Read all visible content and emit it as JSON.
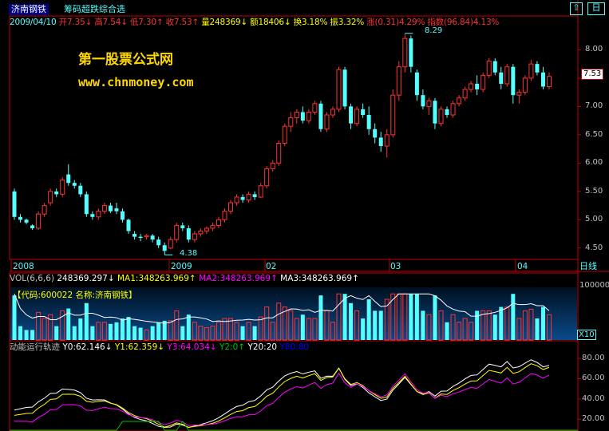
{
  "window": {
    "stock_name": "济南钢铁",
    "indicator_name": "筹码超跌综合选",
    "pct_label": "日"
  },
  "quote": {
    "date": "2009/04/10",
    "open": "开7.35",
    "high": "高7.54",
    "low": "低7.30",
    "close": "收7.53",
    "volume": "量248369",
    "amount": "额18406",
    "turnover": "换3.18%",
    "amplitude": "振3.32%",
    "change": "涨(0.31)4.29%",
    "index": "指数(96.84)4.13%"
  },
  "watermark": {
    "line1": "第一股票公式网",
    "line2": "www.chnmoney.com"
  },
  "colors": {
    "up": "#ff3232",
    "down": "#54ffff",
    "axis": "#c00000",
    "panel_text": "#54ffff",
    "white_line": "#ffffff",
    "yellow_line": "#ffff00",
    "magenta_line": "#ff00ff",
    "green_line": "#00c000",
    "watermark": "#ffd700"
  },
  "x_axis": {
    "labels": [
      "2008",
      "2009",
      "02",
      "03",
      "04"
    ],
    "period_label": "日线"
  },
  "vol_panel": {
    "label": "VOL(6,6,6)",
    "value": "248369.297",
    "ma1": "MA1:348263.969",
    "ma2": "MA2:348263.969",
    "ma3": "MA3:348263.969",
    "info": "【代码:600022 名称:济南钢铁】",
    "scale_label": "X10",
    "ticks": [
      "100000"
    ]
  },
  "energy_panel": {
    "label": "动能运行轨迹",
    "y0": "Y0:62.146",
    "y1": "Y1:62.359",
    "y3": "Y3:64.034",
    "y2": "Y2:0",
    "y20": "Y20:20",
    "y80": "Y80:80",
    "ticks": [
      "80.00",
      "60.00",
      "40.00",
      "20.00"
    ]
  },
  "chart_data": {
    "type": "candlestick",
    "y_ticks": [
      "8.00",
      "7.50",
      "7.00",
      "6.50",
      "6.00",
      "5.50",
      "5.00",
      "4.50"
    ],
    "ylim": [
      4.3,
      8.4
    ],
    "last_price": "7.53",
    "annotations": [
      {
        "text": "8.29",
        "index": 65,
        "value": 8.29
      },
      {
        "text": "4.38",
        "index": 25,
        "value": 4.38
      }
    ],
    "candles": [
      [
        5.5,
        5.55,
        5.0,
        5.05
      ],
      [
        5.05,
        5.1,
        4.95,
        5.0
      ],
      [
        5.0,
        5.02,
        4.92,
        4.95
      ],
      [
        4.9,
        4.92,
        4.82,
        4.85
      ],
      [
        4.85,
        5.15,
        4.82,
        5.1
      ],
      [
        5.1,
        5.3,
        5.05,
        5.25
      ],
      [
        5.3,
        5.55,
        5.25,
        5.5
      ],
      [
        5.5,
        5.55,
        5.4,
        5.45
      ],
      [
        5.45,
        5.75,
        5.4,
        5.7
      ],
      [
        5.8,
        5.98,
        5.6,
        5.65
      ],
      [
        5.65,
        5.7,
        5.55,
        5.6
      ],
      [
        5.6,
        5.65,
        5.4,
        5.45
      ],
      [
        5.45,
        5.5,
        5.05,
        5.1
      ],
      [
        5.1,
        5.15,
        5.0,
        5.05
      ],
      [
        5.05,
        5.2,
        5.0,
        5.15
      ],
      [
        5.15,
        5.3,
        5.1,
        5.25
      ],
      [
        5.25,
        5.3,
        5.12,
        5.15
      ],
      [
        5.2,
        5.3,
        5.1,
        5.15
      ],
      [
        5.15,
        5.2,
        4.95,
        5.0
      ],
      [
        5.0,
        5.02,
        4.75,
        4.8
      ],
      [
        4.75,
        4.8,
        4.65,
        4.7
      ],
      [
        4.7,
        4.75,
        4.62,
        4.68
      ],
      [
        4.7,
        4.75,
        4.65,
        4.72
      ],
      [
        4.72,
        4.75,
        4.6,
        4.65
      ],
      [
        4.65,
        4.7,
        4.5,
        4.55
      ],
      [
        4.55,
        4.6,
        4.38,
        4.45
      ],
      [
        4.5,
        4.7,
        4.48,
        4.65
      ],
      [
        4.65,
        4.95,
        4.6,
        4.9
      ],
      [
        4.9,
        4.95,
        4.8,
        4.85
      ],
      [
        4.85,
        4.9,
        4.6,
        4.65
      ],
      [
        4.65,
        4.8,
        4.6,
        4.75
      ],
      [
        4.75,
        4.85,
        4.7,
        4.8
      ],
      [
        4.8,
        4.88,
        4.75,
        4.85
      ],
      [
        4.85,
        4.95,
        4.8,
        4.9
      ],
      [
        4.9,
        5.05,
        4.85,
        5.0
      ],
      [
        5.0,
        5.2,
        4.95,
        5.15
      ],
      [
        5.15,
        5.35,
        5.1,
        5.3
      ],
      [
        5.3,
        5.45,
        5.25,
        5.4
      ],
      [
        5.4,
        5.45,
        5.3,
        5.35
      ],
      [
        5.35,
        5.5,
        5.3,
        5.45
      ],
      [
        5.45,
        5.5,
        5.35,
        5.4
      ],
      [
        5.4,
        5.65,
        5.38,
        5.6
      ],
      [
        5.6,
        5.95,
        5.55,
        5.9
      ],
      [
        5.9,
        6.05,
        5.85,
        6.0
      ],
      [
        6.0,
        6.4,
        5.95,
        6.35
      ],
      [
        6.35,
        6.7,
        6.3,
        6.65
      ],
      [
        6.65,
        6.9,
        6.55,
        6.8
      ],
      [
        6.8,
        6.95,
        6.7,
        6.9
      ],
      [
        6.9,
        7.0,
        6.7,
        6.75
      ],
      [
        6.75,
        6.95,
        6.7,
        6.9
      ],
      [
        6.9,
        7.1,
        6.85,
        7.05
      ],
      [
        7.05,
        7.1,
        6.55,
        6.6
      ],
      [
        6.6,
        6.9,
        6.55,
        6.85
      ],
      [
        6.85,
        7.0,
        6.8,
        6.95
      ],
      [
        6.95,
        7.7,
        6.9,
        7.65
      ],
      [
        7.65,
        7.7,
        6.95,
        7.0
      ],
      [
        7.0,
        7.05,
        6.6,
        6.7
      ],
      [
        6.7,
        7.0,
        6.65,
        6.95
      ],
      [
        6.95,
        7.05,
        6.8,
        6.85
      ],
      [
        6.85,
        7.0,
        6.5,
        6.6
      ],
      [
        6.6,
        6.7,
        6.35,
        6.45
      ],
      [
        6.45,
        6.55,
        6.2,
        6.3
      ],
      [
        6.3,
        6.6,
        6.1,
        6.5
      ],
      [
        6.5,
        7.3,
        6.45,
        7.2
      ],
      [
        7.2,
        7.8,
        7.1,
        7.7
      ],
      [
        7.7,
        8.29,
        7.6,
        8.2
      ],
      [
        8.2,
        8.25,
        7.6,
        7.7
      ],
      [
        7.6,
        7.65,
        7.1,
        7.2
      ],
      [
        7.2,
        7.3,
        6.95,
        7.0
      ],
      [
        7.0,
        7.15,
        6.85,
        7.1
      ],
      [
        7.1,
        7.15,
        6.6,
        6.7
      ],
      [
        6.7,
        7.0,
        6.65,
        6.95
      ],
      [
        6.95,
        7.0,
        6.8,
        6.85
      ],
      [
        6.85,
        7.1,
        6.8,
        7.05
      ],
      [
        7.05,
        7.2,
        7.0,
        7.15
      ],
      [
        7.15,
        7.35,
        7.1,
        7.3
      ],
      [
        7.3,
        7.45,
        7.25,
        7.4
      ],
      [
        7.4,
        7.55,
        7.2,
        7.3
      ],
      [
        7.3,
        7.6,
        7.25,
        7.55
      ],
      [
        7.55,
        7.85,
        7.5,
        7.8
      ],
      [
        7.8,
        7.85,
        7.55,
        7.6
      ],
      [
        7.6,
        7.7,
        7.3,
        7.4
      ],
      [
        7.4,
        7.75,
        7.35,
        7.7
      ],
      [
        7.7,
        7.75,
        7.05,
        7.2
      ],
      [
        7.2,
        7.3,
        7.05,
        7.25
      ],
      [
        7.25,
        7.55,
        7.2,
        7.5
      ],
      [
        7.5,
        7.82,
        7.45,
        7.75
      ],
      [
        7.75,
        7.8,
        7.55,
        7.6
      ],
      [
        7.6,
        7.7,
        7.3,
        7.35
      ],
      [
        7.35,
        7.6,
        7.3,
        7.53
      ]
    ]
  }
}
